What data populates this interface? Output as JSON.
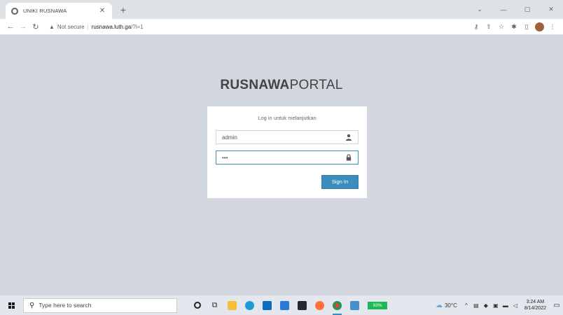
{
  "browser": {
    "tab": {
      "title": "UNIKI RUSNAWA",
      "close_icon": "✕"
    },
    "newtab_icon": "+",
    "window_controls": [
      "⌄",
      "—",
      "▢",
      "✕"
    ],
    "address": {
      "security_label": "Not secure",
      "url_host": "rusnawa.luth.ga",
      "url_path": "/?l=1"
    }
  },
  "page": {
    "brand_bold": "RUSNAWA",
    "brand_light": "PORTAL",
    "login_message": "Log in untuk melanjutkan",
    "username_value": "admin",
    "password_value": "•••",
    "signin_label": "Sign In",
    "colors": {
      "primary": "#3c8dbc",
      "background": "#d2d6de"
    }
  },
  "taskbar": {
    "search_placeholder": "Type here to search",
    "battery": "93%",
    "weather": "30°C",
    "time": "3:24 AM",
    "date": "8/14/2022"
  }
}
